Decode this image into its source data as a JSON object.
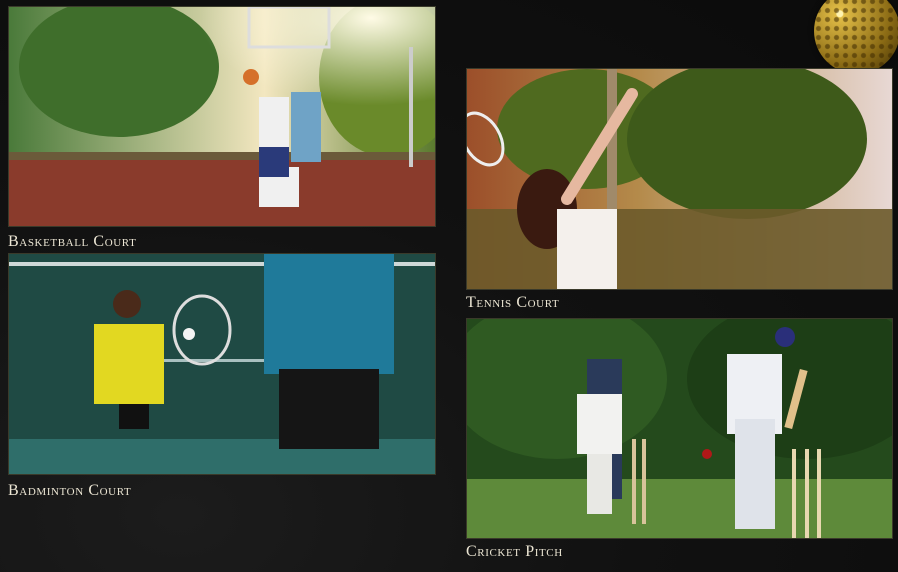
{
  "facilities": [
    {
      "key": "basketball",
      "label": "Basketball Court"
    },
    {
      "key": "tennis",
      "label": "Tennis Court"
    },
    {
      "key": "badminton",
      "label": "Badminton Court"
    },
    {
      "key": "cricket",
      "label": "Cricket Pitch"
    }
  ],
  "colors": {
    "background": "#111111",
    "caption": "#ece6d4",
    "accent_gold": "#d9b23c"
  },
  "icons": {
    "decor": "golf-ball-icon"
  }
}
